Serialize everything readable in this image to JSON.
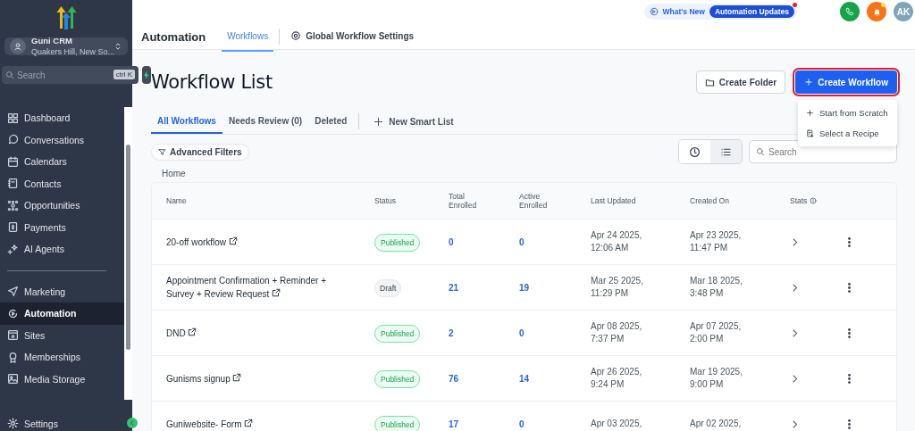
{
  "sidebar": {
    "account": {
      "name": "Guni CRM",
      "location": "Quakers Hill, New So..."
    },
    "search": {
      "placeholder": "Search",
      "shortcut": "ctrl K"
    },
    "groups": [
      [
        {
          "label": "Dashboard",
          "selected": false
        },
        {
          "label": "Conversations",
          "selected": false
        },
        {
          "label": "Calendars",
          "selected": false
        },
        {
          "label": "Contacts",
          "selected": false
        },
        {
          "label": "Opportunities",
          "selected": false
        },
        {
          "label": "Payments",
          "selected": false
        },
        {
          "label": "AI Agents",
          "selected": false
        }
      ],
      [
        {
          "label": "Marketing",
          "selected": false
        },
        {
          "label": "Automation",
          "selected": true
        },
        {
          "label": "Sites",
          "selected": false
        },
        {
          "label": "Memberships",
          "selected": false
        },
        {
          "label": "Media Storage",
          "selected": false
        }
      ]
    ],
    "settings": "Settings"
  },
  "topbar": {
    "title": "Automation",
    "tabs": [
      {
        "label": "Workflows",
        "selected": true
      },
      {
        "label": "Global Workflow Settings",
        "selected": false
      }
    ],
    "whats_new": "What's New",
    "updates_badge": "Automation Updates",
    "avatar": "AK"
  },
  "page": {
    "title": "Workflow List",
    "create_folder": "Create Folder",
    "create_workflow": "Create Workflow",
    "menu": [
      "Start from Scratch",
      "Select a Recipe"
    ],
    "tabs": [
      {
        "label": "All Workflows",
        "selected": true
      },
      {
        "label": "Needs Review (0)",
        "selected": false
      },
      {
        "label": "Deleted",
        "selected": false
      }
    ],
    "new_smart_list": "New Smart List",
    "advanced_filters": "Advanced Filters",
    "view_toggle": [
      {
        "selected": false
      },
      {
        "selected": true
      }
    ],
    "search": {
      "placeholder": "Search"
    },
    "breadcrumb": "Home"
  },
  "table": {
    "columns": [
      "Name",
      "Status",
      "Total Enrolled",
      "Active Enrolled",
      "Last Updated",
      "Created On",
      "Stats"
    ],
    "rows": [
      {
        "name": "20-off workflow",
        "status": {
          "label": "Published",
          "kind": "published"
        },
        "total": "0",
        "active": "0",
        "last_updated": [
          "Apr 24 2025,",
          "12:06 AM"
        ],
        "created_on": [
          "Apr 23 2025,",
          "11:47 PM"
        ]
      },
      {
        "name": "Appointment Confirmation + Reminder + Survey + Review Request",
        "status": {
          "label": "Draft",
          "kind": "draft"
        },
        "total": "21",
        "active": "19",
        "last_updated": [
          "Mar 25 2025,",
          "11:29 PM"
        ],
        "created_on": [
          "Mar 18 2025,",
          "3:48 PM"
        ]
      },
      {
        "name": "DND",
        "status": {
          "label": "Published",
          "kind": "published"
        },
        "total": "2",
        "active": "0",
        "last_updated": [
          "Apr 08 2025,",
          "7:37 PM"
        ],
        "created_on": [
          "Apr 07 2025,",
          "2:00 PM"
        ]
      },
      {
        "name": "Gunisms signup",
        "status": {
          "label": "Published",
          "kind": "published"
        },
        "total": "76",
        "active": "14",
        "last_updated": [
          "Apr 26 2025,",
          "9:24 PM"
        ],
        "created_on": [
          "Mar 19 2025,",
          "9:00 PM"
        ]
      },
      {
        "name": "Guniwebsite- Form",
        "status": {
          "label": "Published",
          "kind": "published"
        },
        "total": "17",
        "active": "0",
        "last_updated": [
          "Apr 03 2025,"
        ],
        "created_on": [
          "Apr 02 2025,"
        ]
      }
    ]
  }
}
